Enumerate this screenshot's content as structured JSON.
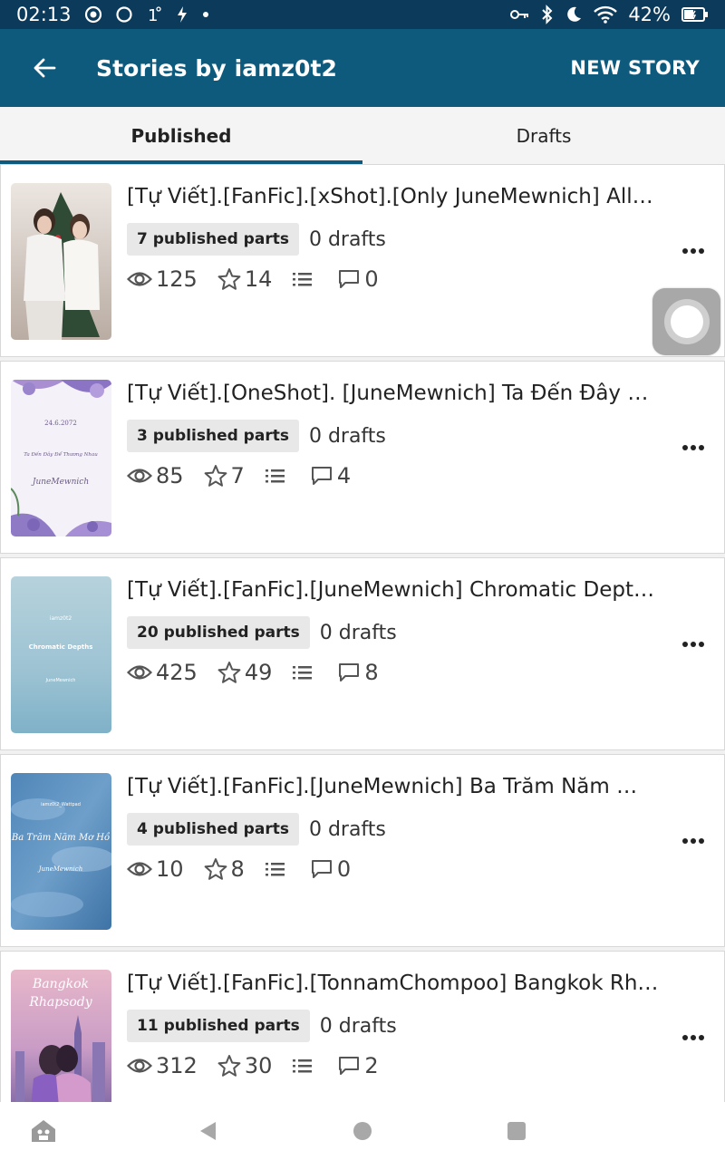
{
  "status_bar": {
    "time": "02:13",
    "battery_percent": "42%",
    "left_icons": [
      "record-icon",
      "circle-icon",
      "temperature-icon",
      "flash-icon",
      "dot-icon"
    ],
    "right_icons": [
      "key-icon",
      "bluetooth-icon",
      "moon-icon",
      "wifi-icon",
      "battery-icon"
    ]
  },
  "app_bar": {
    "title": "Stories by iamz0t2",
    "action_label": "NEW STORY"
  },
  "tabs": [
    {
      "label": "Published",
      "active": true
    },
    {
      "label": "Drafts",
      "active": false
    }
  ],
  "stories": [
    {
      "title": "[Tự Viết].[FanFic].[xShot].[Only JuneMewnich] All…",
      "published_parts": "7 published parts",
      "drafts": "0 drafts",
      "reads": "125",
      "votes": "14",
      "comments": "0",
      "cover": {
        "text": []
      }
    },
    {
      "title": "[Tự Viết].[OneShot]. [JuneMewnich] Ta Đến Đây …",
      "published_parts": "3 published parts",
      "drafts": "0 drafts",
      "reads": "85",
      "votes": "7",
      "comments": "4",
      "cover": {
        "text": [
          "24.6.2072",
          "Ta Đến Đây Để Thương Nhau",
          "JuneMewnich"
        ]
      }
    },
    {
      "title": "[Tự Viết].[FanFic].[JuneMewnich] Chromatic Dept…",
      "published_parts": "20 published parts",
      "drafts": "0 drafts",
      "reads": "425",
      "votes": "49",
      "comments": "8",
      "cover": {
        "text": [
          "iamz0t2",
          "Chromatic Depths",
          "JuneMewnich"
        ]
      }
    },
    {
      "title": "[Tự Viết].[FanFic].[JuneMewnich] Ba Trăm Năm …",
      "published_parts": "4 published parts",
      "drafts": "0 drafts",
      "reads": "10",
      "votes": "8",
      "comments": "0",
      "cover": {
        "text": [
          "iamz0t2_Wattpad",
          "Ba Trăm Năm Mơ Hồ",
          "JuneMewnich"
        ]
      }
    },
    {
      "title": "[Tự Viết].[FanFic].[TonnamChompoo] Bangkok Rh…",
      "published_parts": "11 published parts",
      "drafts": "0 drafts",
      "reads": "312",
      "votes": "30",
      "comments": "2",
      "cover": {
        "text": [
          "Bangkok",
          "Rhapsody"
        ]
      }
    }
  ],
  "icons": {
    "reads": "eye-icon",
    "votes": "star-icon",
    "parts": "list-icon",
    "comments": "comment-icon",
    "more": "more-dots-icon"
  },
  "colors": {
    "status_bar": "#0b3a5b",
    "app_bar": "#0d5a7d",
    "tab_indicator": "#0d5a7d"
  },
  "nav_bar": {
    "items": [
      "keyboard-assist-icon",
      "back-triangle-icon",
      "home-circle-icon",
      "recents-square-icon"
    ]
  }
}
